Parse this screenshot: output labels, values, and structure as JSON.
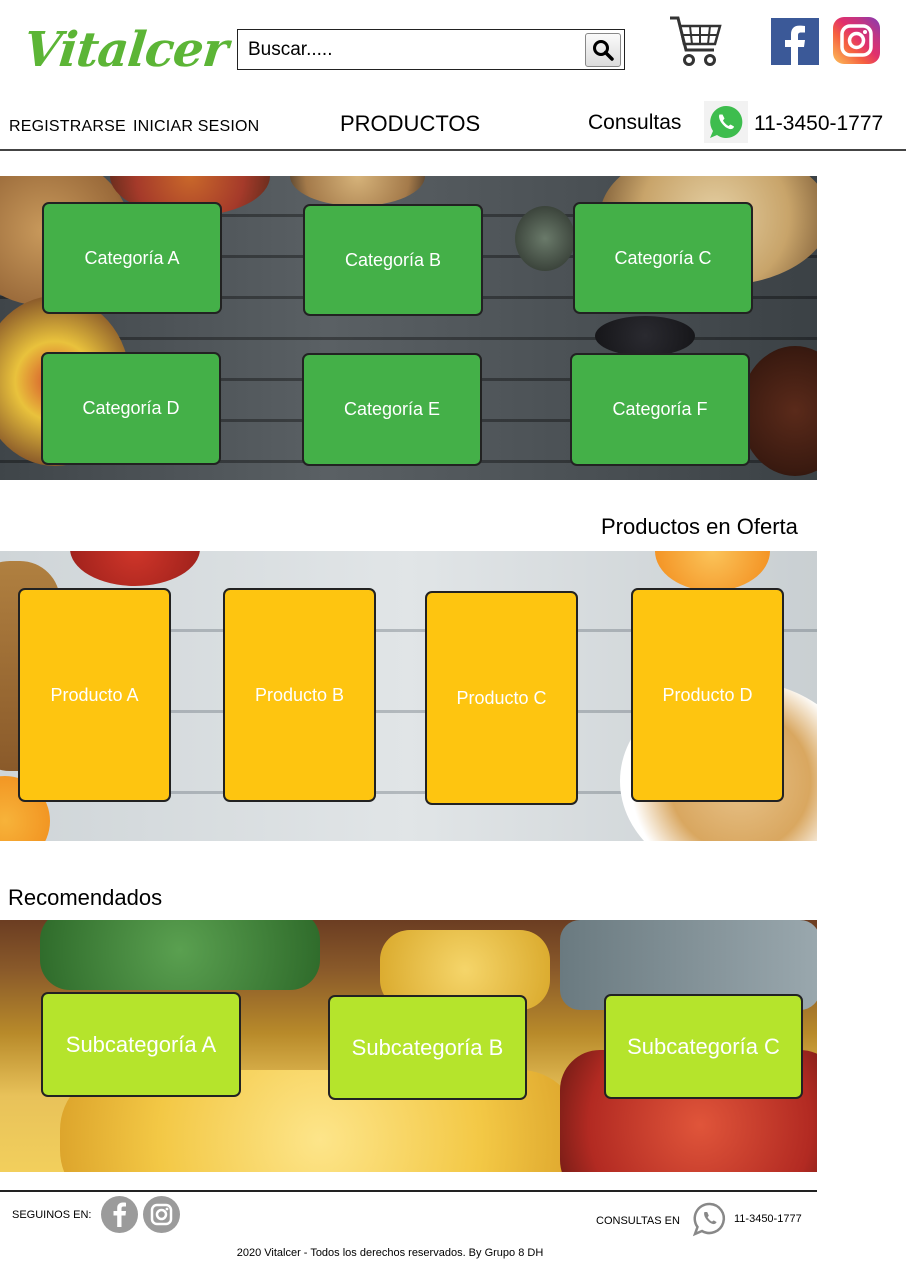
{
  "brand": {
    "name": "Vitalcer"
  },
  "search": {
    "placeholder": "Buscar.....",
    "icon": "magnifier"
  },
  "header": {
    "cart_icon": "shopping-cart",
    "social": [
      "facebook",
      "instagram"
    ],
    "nav": {
      "register": "REGISTRARSE",
      "login": "INICIAR SESION",
      "products": "PRODUCTOS",
      "consultas": "Consultas",
      "phone": "11-3450-1777"
    }
  },
  "categories": [
    "Categoría A",
    "Categoría B",
    "Categoría C",
    "Categoría D",
    "Categoría E",
    "Categoría F"
  ],
  "offers": {
    "title": "Productos en Oferta",
    "items": [
      "Producto A",
      "Producto B",
      "Producto C",
      "Producto D"
    ]
  },
  "recommended": {
    "title": "Recomendados",
    "items": [
      "Subcategoría A",
      "Subcategoría B",
      "Subcategoría C"
    ]
  },
  "footer": {
    "follow": "SEGUINOS EN:",
    "consultas": "CONSULTAS EN",
    "phone": "11-3450-1777",
    "copyright": "2020 Vitalcer - Todos los derechos reservados. By Grupo 8 DH"
  },
  "colors": {
    "brand_green": "#5cb536",
    "category_green": "#44b048",
    "offer_yellow": "#fec510",
    "subcategory_lime": "#b5e42c"
  }
}
